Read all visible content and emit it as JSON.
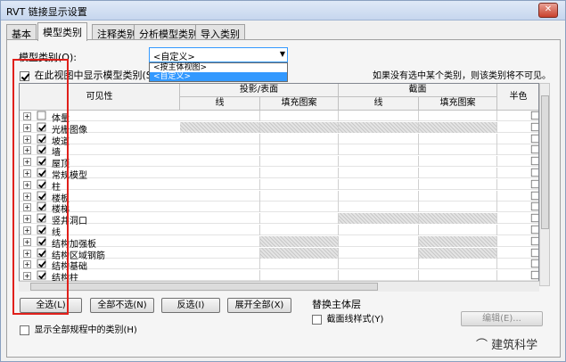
{
  "window": {
    "title": "RVT 链接显示设置"
  },
  "tabs": [
    {
      "label": "基本"
    },
    {
      "label": "模型类别"
    },
    {
      "label": "注释类别"
    },
    {
      "label": "分析模型类别"
    },
    {
      "label": "导入类别"
    }
  ],
  "model_category": {
    "label": "模型类别(O):",
    "value": "<自定义>",
    "options": [
      "<按主体视图>",
      "<自定义>"
    ]
  },
  "show_in_view": {
    "label": "在此视图中显示模型类别(S)",
    "checked": true
  },
  "hint": "如果没有选中某个类别，则该类别将不可见。",
  "columns": {
    "visibility": "可见性",
    "projection": "投影/表面",
    "cut": "截面",
    "half": "半色",
    "line": "线",
    "fill": "填充图案"
  },
  "rows": [
    {
      "label": "体量",
      "checked": false
    },
    {
      "label": "光栅图像",
      "checked": true
    },
    {
      "label": "坡道",
      "checked": true
    },
    {
      "label": "墙",
      "checked": true
    },
    {
      "label": "屋顶",
      "checked": true
    },
    {
      "label": "常规模型",
      "checked": true
    },
    {
      "label": "柱",
      "checked": true
    },
    {
      "label": "楼板",
      "checked": true
    },
    {
      "label": "楼梯",
      "checked": true
    },
    {
      "label": "竖井洞口",
      "checked": true
    },
    {
      "label": "线",
      "checked": true
    },
    {
      "label": "结构加强板",
      "checked": true
    },
    {
      "label": "结构区域钢筋",
      "checked": true
    },
    {
      "label": "结构基础",
      "checked": true
    },
    {
      "label": "结构柱",
      "checked": true
    }
  ],
  "buttons": {
    "select_all": "全选(L)",
    "select_none": "全部不选(N)",
    "invert": "反选(I)",
    "expand_all": "展开全部(X)",
    "edit": "编辑(E)..."
  },
  "override_host": {
    "label": "替换主体层",
    "cut_line": "截面线样式(Y)"
  },
  "show_all_disciplines": "显示全部规程中的类别(H)",
  "watermark": "建筑科学"
}
